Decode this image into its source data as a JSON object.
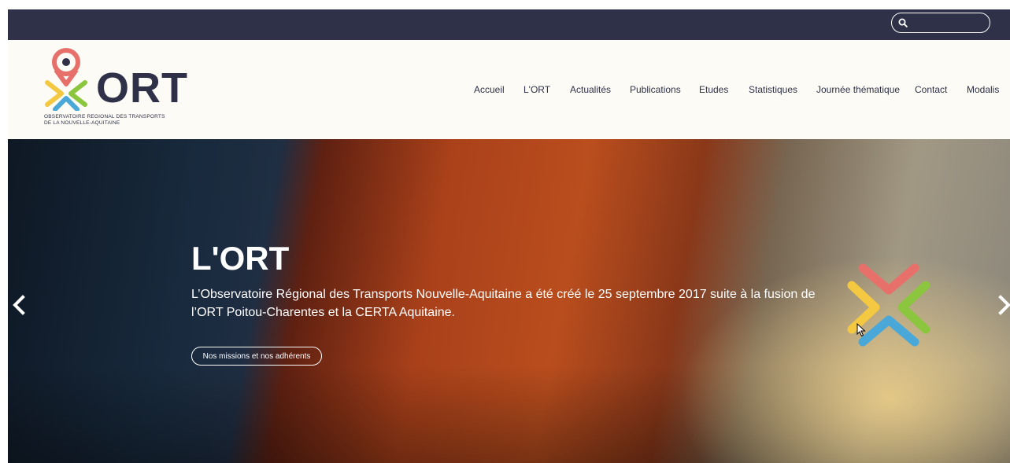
{
  "search": {
    "placeholder": "",
    "value": "",
    "icon": "search-icon"
  },
  "logo": {
    "name": "ORT",
    "subtitle_line1": "OBSERVATOIRE REGIONAL DES TRANSPORTS",
    "subtitle_line2": "DE LA NOUVELLE-AQUITAINE",
    "icon": "map-pin-cross-icon"
  },
  "nav": {
    "items": [
      {
        "label": "Accueil"
      },
      {
        "label": "L'ORT"
      },
      {
        "label": "Actualités"
      },
      {
        "label": "Publications"
      },
      {
        "label": "Etudes"
      },
      {
        "label": "Statistiques"
      },
      {
        "label": "Journée thématique"
      },
      {
        "label": "Contact"
      },
      {
        "label": "Modalis"
      }
    ]
  },
  "hero": {
    "title": "L'ORT",
    "text": "L’Observatoire Régional des Transports Nouvelle-Aquitaine a été créé le 25 septembre 2017 suite à la fusion de l’ORT Poitou-Charentes et la CERTA Aquitaine.",
    "button_label": "Nos missions et nos adhérents",
    "prev_icon": "chevron-left-icon",
    "next_icon": "chevron-right-icon"
  },
  "colors": {
    "topbar": "#2e3147",
    "header_bg": "#fcfbf6",
    "brand_navy": "#2e3147",
    "mark_red": "#e8706a",
    "mark_yellow": "#f5c842",
    "mark_green": "#8cc63f",
    "mark_blue": "#4aa8d8"
  }
}
